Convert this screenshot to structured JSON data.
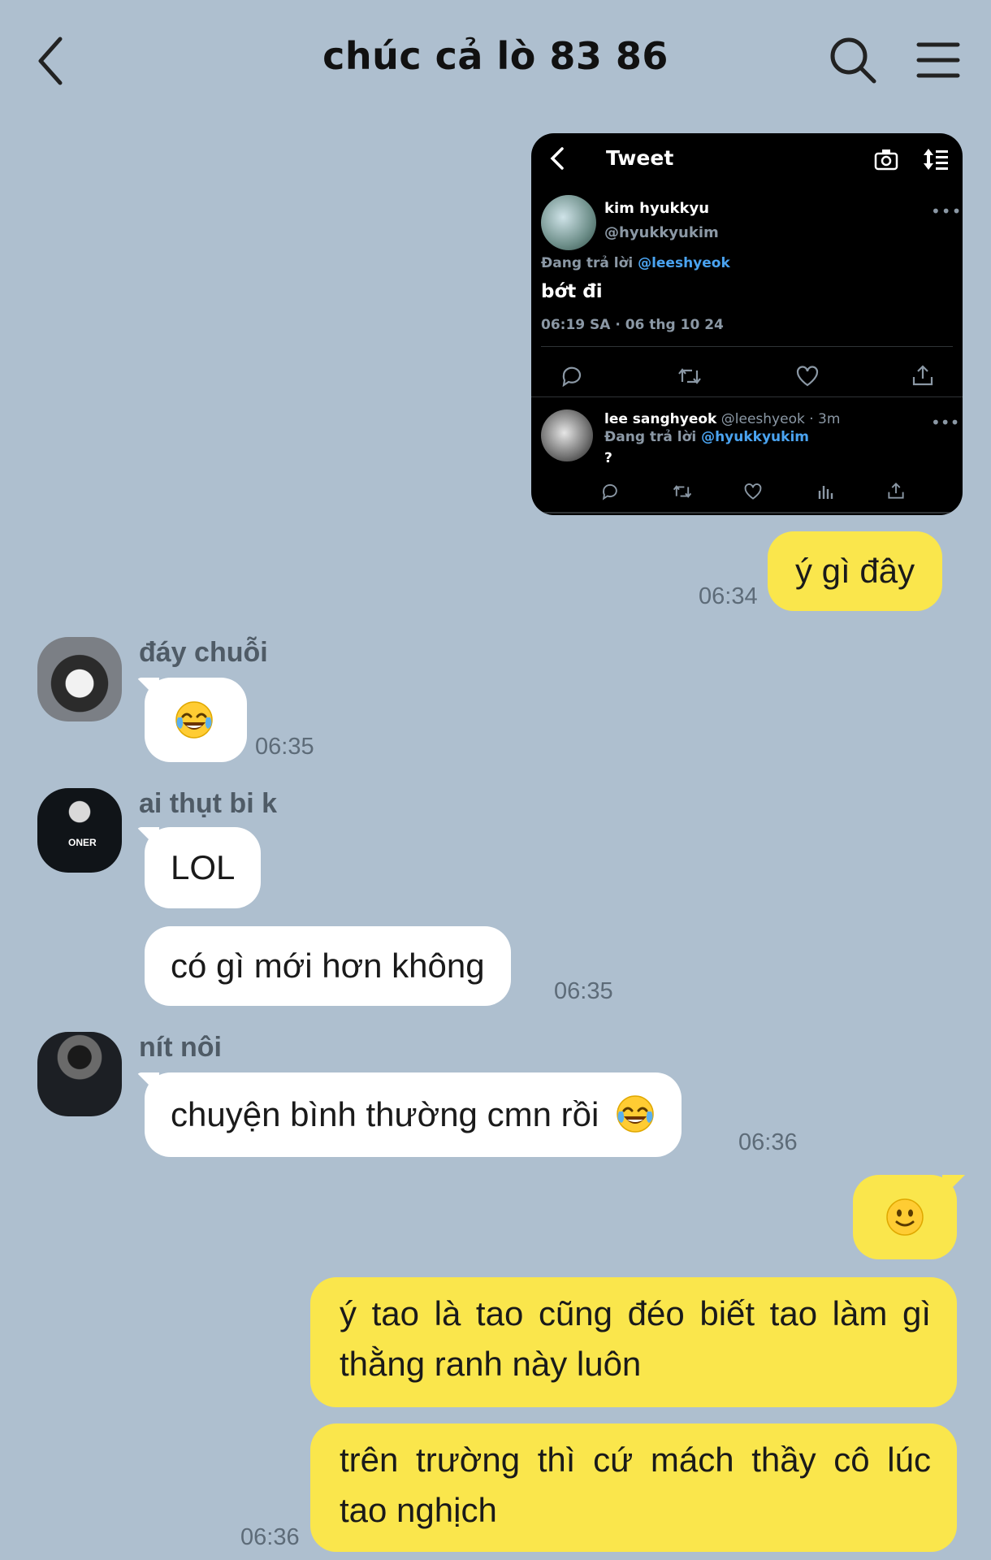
{
  "header": {
    "title": "chúc cả lò 83 86"
  },
  "tweet": {
    "screen_title": "Tweet",
    "author_name": "kim hyukkyu",
    "author_handle": "@hyukkyukim",
    "replying_prefix": "Đang trả lời ",
    "replying_to": "@leeshyeok",
    "text": "bớt đi",
    "timestamp": "06:19 SA · 06 thg 10 24",
    "reply_name": "lee sanghyeok",
    "reply_handle": " @leeshyeok · 3m",
    "reply_replying_to": "@hyukkyukim",
    "reply_text": "?"
  },
  "messages": {
    "m1": {
      "text": "ý gì đây",
      "time": "06:34"
    },
    "m2": {
      "sender": "đáy chuỗi",
      "emoji": "face-with-tears-of-joy",
      "time": "06:35"
    },
    "m3": {
      "sender": "ai thụt bi k",
      "text": "LOL",
      "avatar_text": "ONER"
    },
    "m4": {
      "text": "có gì mới hơn không",
      "time": "06:35"
    },
    "m5": {
      "sender": "nít nôi",
      "text": "chuyện bình thường cmn rồi",
      "emoji": "face-with-tears-of-joy",
      "time": "06:36"
    },
    "m6": {
      "emoji": "slightly-smiling-face"
    },
    "m7": {
      "text": "ý tao là tao cũng đéo biết tao làm gì thằng ranh này luôn"
    },
    "m8": {
      "text": "trên trường thì cứ mách thầy cô lúc tao nghịch",
      "time": "06:36"
    }
  },
  "colors": {
    "background": "#aebfcf",
    "incoming_bubble": "#ffffff",
    "outgoing_bubble": "#fae64c",
    "mention": "#4aa3f0"
  }
}
